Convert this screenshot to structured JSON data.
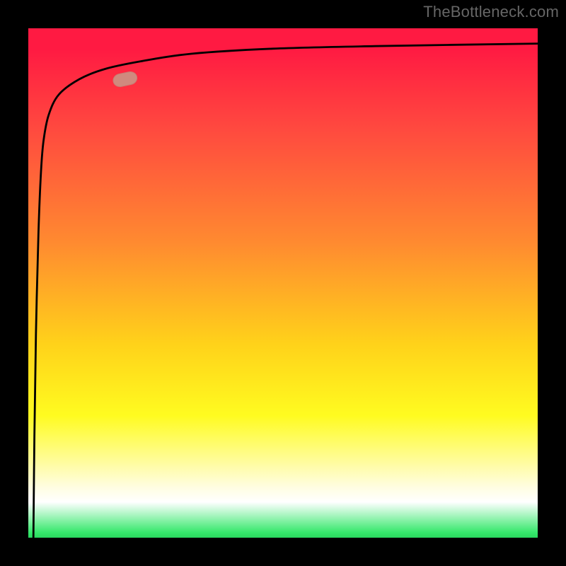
{
  "watermark": "TheBottleneck.com",
  "colors": {
    "curve": "#000000",
    "marker_fill": "#d08a7e",
    "marker_stroke": "#c77e73",
    "gradient_top": "#ff1a42",
    "gradient_mid1": "#ff8a30",
    "gradient_mid2": "#fffb20",
    "gradient_pale": "#fffde0",
    "gradient_bottom": "#2ad85f",
    "frame": "#000000"
  },
  "chart_data": {
    "type": "line",
    "title": "",
    "xlabel": "",
    "ylabel": "",
    "xlim": [
      0,
      1
    ],
    "ylim": [
      0,
      1
    ],
    "series": [
      {
        "name": "curve",
        "x": [
          0.01,
          0.012,
          0.015,
          0.02,
          0.025,
          0.03,
          0.04,
          0.06,
          0.1,
          0.15,
          0.22,
          0.32,
          0.48,
          0.68,
          1.0
        ],
        "y": [
          0.0,
          0.2,
          0.4,
          0.6,
          0.72,
          0.78,
          0.83,
          0.87,
          0.9,
          0.92,
          0.935,
          0.95,
          0.96,
          0.965,
          0.97
        ]
      }
    ],
    "annotations": [
      {
        "name": "marker",
        "x": 0.19,
        "y": 0.9,
        "shape": "pill-marker"
      }
    ],
    "background_gradient": {
      "axis": "y",
      "stops": [
        {
          "pos": 0.0,
          "color": "#2ad85f"
        },
        {
          "pos": 0.02,
          "color": "#35e86b"
        },
        {
          "pos": 0.07,
          "color": "#ffffff"
        },
        {
          "pos": 0.1,
          "color": "#fffde0"
        },
        {
          "pos": 0.24,
          "color": "#fffb20"
        },
        {
          "pos": 0.38,
          "color": "#ffd21a"
        },
        {
          "pos": 0.58,
          "color": "#ff8a30"
        },
        {
          "pos": 0.8,
          "color": "#ff4a3f"
        },
        {
          "pos": 1.0,
          "color": "#ff1a42"
        }
      ]
    }
  }
}
